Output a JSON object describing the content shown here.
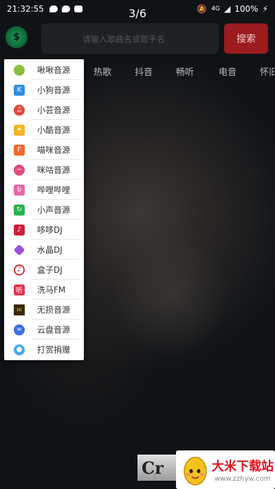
{
  "status_bar": {
    "time": "21:32:55",
    "battery": "100%",
    "signal": "4G"
  },
  "page_counter": "3/6",
  "header": {
    "search_placeholder": "请输入歌曲名或歌手名",
    "search_button": "搜索"
  },
  "tabs": [
    "热歌",
    "抖音",
    "畅听",
    "电音",
    "怀旧"
  ],
  "sources": [
    {
      "label": "啾啾音源",
      "icon": "leaf-icon",
      "color": "#8bbf3f"
    },
    {
      "label": "小狗音源",
      "icon": "dog-icon",
      "color": "#2f8fe0"
    },
    {
      "label": "小芸音源",
      "icon": "cloud-music-icon",
      "color": "#e8473a"
    },
    {
      "label": "小酷音源",
      "icon": "ku-icon",
      "color": "#f2b523"
    },
    {
      "label": "喵咪音源",
      "icon": "cat-icon",
      "color": "#ef6b2d"
    },
    {
      "label": "咪咕音源",
      "icon": "migu-icon",
      "color": "#e24b7a"
    },
    {
      "label": "哔哩哔哩",
      "icon": "bilibili-icon",
      "color": "#e56aa6"
    },
    {
      "label": "小声音源",
      "icon": "refresh-icon",
      "color": "#27b24b"
    },
    {
      "label": "哆哆DJ",
      "icon": "dj-icon",
      "color": "#c8223b"
    },
    {
      "label": "水晶DJ",
      "icon": "crystal-icon",
      "color": "#9a53d9"
    },
    {
      "label": "盒子DJ",
      "icon": "box-icon",
      "color": "#d23232"
    },
    {
      "label": "洗马FM",
      "icon": "fm-icon",
      "color": "#e0364f"
    },
    {
      "label": "无损音源",
      "icon": "hires-icon",
      "color": "#a27a15"
    },
    {
      "label": "云盘音源",
      "icon": "cloud-drive-icon",
      "color": "#3a6fe0"
    },
    {
      "label": "打赏捐赠",
      "icon": "donate-icon",
      "color": "#4aa9ea"
    }
  ],
  "watermark": {
    "title": "大米下载站",
    "url": "www.zzhyw.com"
  },
  "ad_text": "Cr"
}
